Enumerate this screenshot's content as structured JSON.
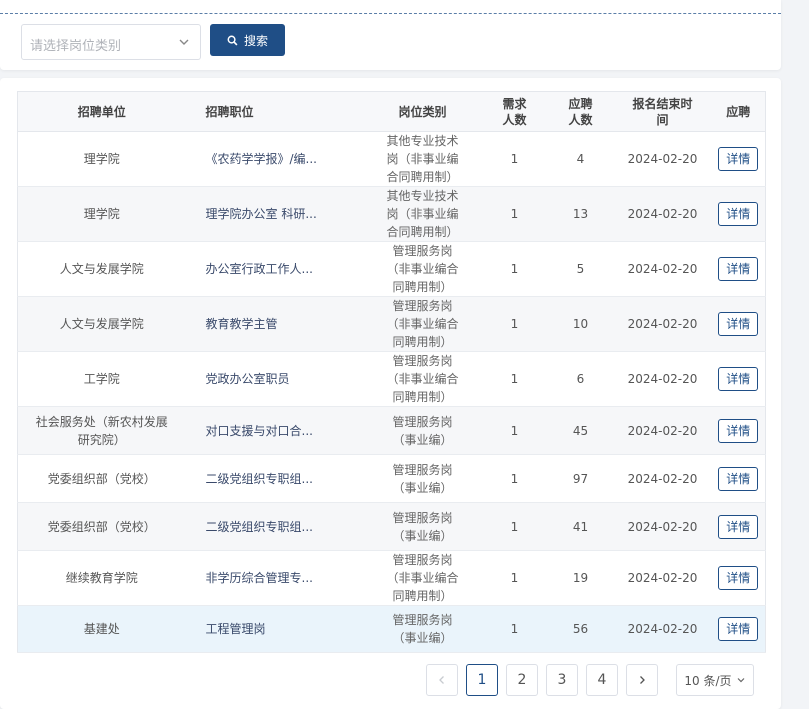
{
  "filter": {
    "placeholder": "请选择岗位类别",
    "search_label": "搜索"
  },
  "table": {
    "headers": {
      "unit": "招聘单位",
      "position": "招聘职位",
      "type": "岗位类别",
      "demand": "需求\n人数",
      "applied": "应聘\n人数",
      "deadline": "报名结束时\n间",
      "apply": "应聘"
    },
    "rows": [
      {
        "unit": "理学院",
        "position": "《农药学学报》/编...",
        "type": "其他专业技术\n岗（非事业编\n合同聘用制）",
        "demand": "1",
        "applied": "4",
        "deadline": "2024-02-20",
        "action": "详情"
      },
      {
        "unit": "理学院",
        "position": "理学院办公室 科研...",
        "type": "其他专业技术\n岗（非事业编\n合同聘用制）",
        "demand": "1",
        "applied": "13",
        "deadline": "2024-02-20",
        "action": "详情"
      },
      {
        "unit": "人文与发展学院",
        "position": "办公室行政工作人...",
        "type": "管理服务岗\n（非事业编合\n同聘用制）",
        "demand": "1",
        "applied": "5",
        "deadline": "2024-02-20",
        "action": "详情"
      },
      {
        "unit": "人文与发展学院",
        "position": "教育教学主管",
        "type": "管理服务岗\n（非事业编合\n同聘用制）",
        "demand": "1",
        "applied": "10",
        "deadline": "2024-02-20",
        "action": "详情"
      },
      {
        "unit": "工学院",
        "position": "党政办公室职员",
        "type": "管理服务岗\n（非事业编合\n同聘用制）",
        "demand": "1",
        "applied": "6",
        "deadline": "2024-02-20",
        "action": "详情"
      },
      {
        "unit": "社会服务处（新农村发展\n研究院）",
        "position": "对口支援与对口合...",
        "type": "管理服务岗\n（事业编）",
        "demand": "1",
        "applied": "45",
        "deadline": "2024-02-20",
        "action": "详情"
      },
      {
        "unit": "党委组织部（党校）",
        "position": "二级党组织专职组...",
        "type": "管理服务岗\n（事业编）",
        "demand": "1",
        "applied": "97",
        "deadline": "2024-02-20",
        "action": "详情"
      },
      {
        "unit": "党委组织部（党校）",
        "position": "二级党组织专职组...",
        "type": "管理服务岗\n（事业编）",
        "demand": "1",
        "applied": "41",
        "deadline": "2024-02-20",
        "action": "详情"
      },
      {
        "unit": "继续教育学院",
        "position": "非学历综合管理专...",
        "type": "管理服务岗\n（非事业编合\n同聘用制）",
        "demand": "1",
        "applied": "19",
        "deadline": "2024-02-20",
        "action": "详情"
      },
      {
        "unit": "基建处",
        "position": "工程管理岗",
        "type": "管理服务岗\n（事业编）",
        "demand": "1",
        "applied": "56",
        "deadline": "2024-02-20",
        "action": "详情"
      }
    ]
  },
  "pagination": {
    "pages": [
      "1",
      "2",
      "3",
      "4"
    ],
    "current": "1",
    "page_size": "10 条/页"
  },
  "colors": {
    "primary": "#1f4e86",
    "row_alt": "#f6f7f9",
    "row_highlight": "#eaf4fb"
  }
}
